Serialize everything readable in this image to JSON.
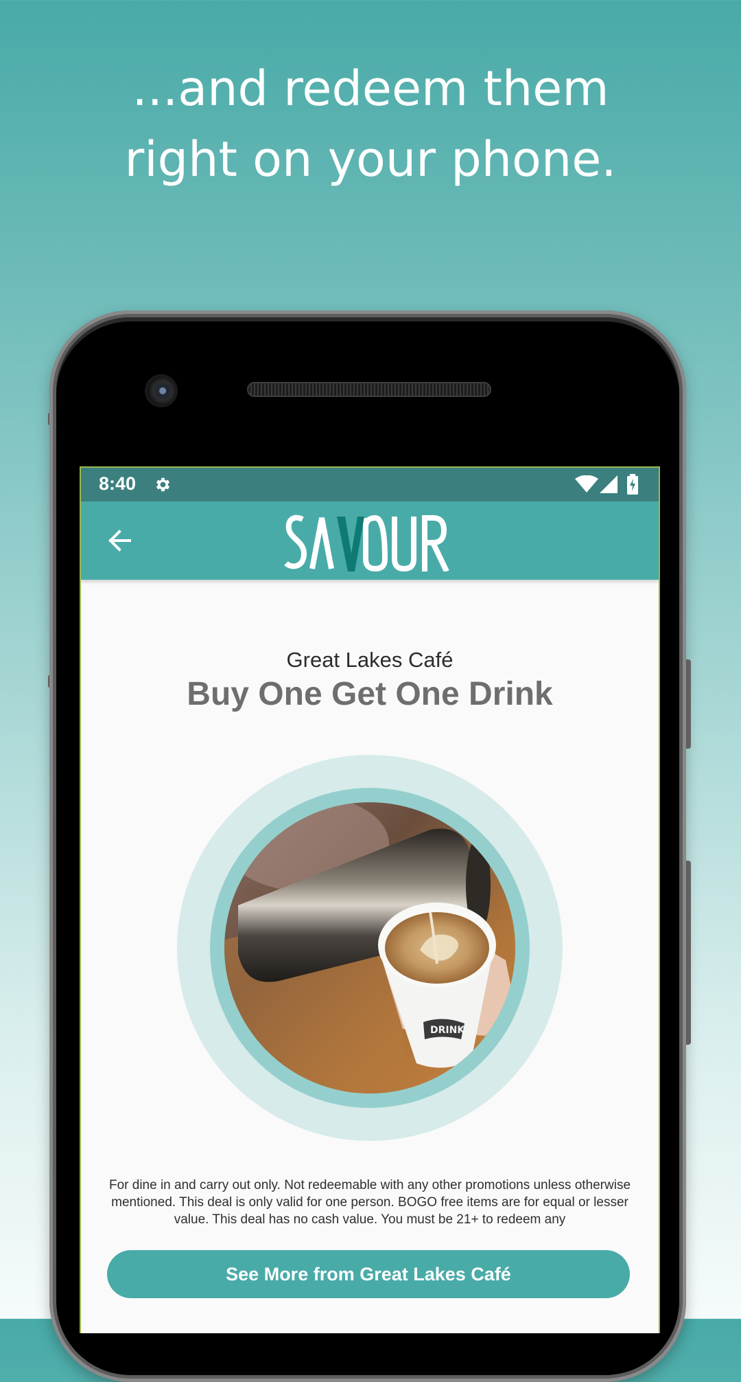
{
  "headline": {
    "line1": "...and redeem them",
    "line2": "right on your phone."
  },
  "status_bar": {
    "time": "8:40",
    "icons": [
      "gear-icon",
      "wifi-icon",
      "cell-signal-icon",
      "battery-charging-icon"
    ]
  },
  "app_bar": {
    "back_icon": "arrow-back-icon",
    "logo_text": "SAVOUR"
  },
  "deal": {
    "merchant": "Great Lakes Café",
    "title": "Buy One Get One Drink",
    "image": "latte-art-pour-photo",
    "fine_print": "For dine in and carry out only. Not redeemable with any other promotions unless otherwise mentioned. This deal is only valid for one person. BOGO free items are for equal or lesser value. This deal has no cash value. You must be 21+ to redeem any",
    "cta_label": "See More from Great Lakes Café"
  },
  "colors": {
    "primary": "#49aba8",
    "status_bar": "#3b807f",
    "logo_accent": "#0e7a73",
    "ring_outer": "#d6ebea",
    "ring_inner": "#95cfcd"
  }
}
